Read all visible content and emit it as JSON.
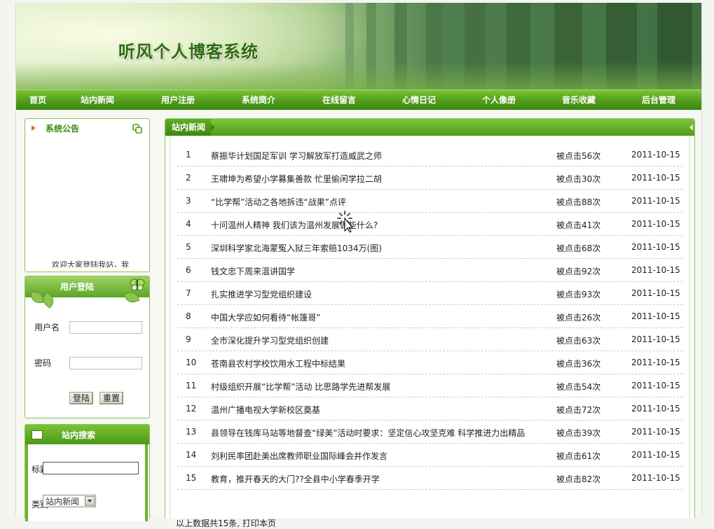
{
  "site": {
    "title": "听风个人博客系统"
  },
  "nav": [
    "首页",
    "站内新闻",
    "用户注册",
    "系统简介",
    "在线留言",
    "心情日记",
    "个人像册",
    "音乐收藏",
    "后台管理"
  ],
  "notice": {
    "title": "系统公告",
    "marquee": "欢迎大家登陆我站，我"
  },
  "login": {
    "title": "用户登陆",
    "username_label": "用户名",
    "password_label": "密码",
    "username_value": "",
    "password_value": "",
    "submit_label": "登陆",
    "reset_label": "重置"
  },
  "search": {
    "title": "站内搜索",
    "title_label": "标题",
    "title_value": "",
    "category_label": "类别",
    "category_value": "站内新闻"
  },
  "news": {
    "tab_label": "站内新闻",
    "rows": [
      {
        "no": "1",
        "title": "蔡振华计划国足军训 学习解放军打造威武之师",
        "clicks": "被点击56次",
        "date": "2011-10-15"
      },
      {
        "no": "2",
        "title": "王啸坤为希望小学募集善款 忙里偷闲学拉二胡",
        "clicks": "被点击30次",
        "date": "2011-10-15"
      },
      {
        "no": "3",
        "title": "“比学帮”活动之各地拆违“战果”点评",
        "clicks": "被点击88次",
        "date": "2011-10-15"
      },
      {
        "no": "4",
        "title": "十问温州人精神 我们该为温州发展做些什么?",
        "clicks": "被点击41次",
        "date": "2011-10-15"
      },
      {
        "no": "5",
        "title": "深圳科学家北海蒙冤入狱三年索赔1034万(图)",
        "clicks": "被点击68次",
        "date": "2011-10-15"
      },
      {
        "no": "6",
        "title": "钱文忠下周来温讲国学",
        "clicks": "被点击92次",
        "date": "2011-10-15"
      },
      {
        "no": "7",
        "title": "扎实推进学习型党组织建设",
        "clicks": "被点击93次",
        "date": "2011-10-15"
      },
      {
        "no": "8",
        "title": "中国大学应如何看待“帐篷哥”",
        "clicks": "被点击26次",
        "date": "2011-10-15"
      },
      {
        "no": "9",
        "title": "全市深化提升学习型党组织创建",
        "clicks": "被点击63次",
        "date": "2011-10-15"
      },
      {
        "no": "10",
        "title": "苍南县农村学校饮用水工程中标结果",
        "clicks": "被点击36次",
        "date": "2011-10-15"
      },
      {
        "no": "11",
        "title": "村级组织开展“比学帮”活动 比思路学先进帮发展",
        "clicks": "被点击54次",
        "date": "2011-10-15"
      },
      {
        "no": "12",
        "title": "温州广播电视大学新校区奠基",
        "clicks": "被点击72次",
        "date": "2011-10-15"
      },
      {
        "no": "13",
        "title": "县领导在钱库马站等地督查“绿美”活动时要求：坚定信心攻坚克难 科学推进力出精品",
        "clicks": "被点击39次",
        "date": "2011-10-15"
      },
      {
        "no": "14",
        "title": "刘利民率团赴美出席教师职业国际峰会并作发言",
        "clicks": "被点击61次",
        "date": "2011-10-15"
      },
      {
        "no": "15",
        "title": "教育，推开春天的大门??全县中小学春季开学",
        "clicks": "被点击82次",
        "date": "2011-10-15"
      }
    ],
    "footer": "以上数据共15条, 打印本页"
  },
  "colors": {
    "nav_green": "#4f9d1b",
    "border_green": "#8cc45a",
    "title_green": "#2f6b12"
  }
}
